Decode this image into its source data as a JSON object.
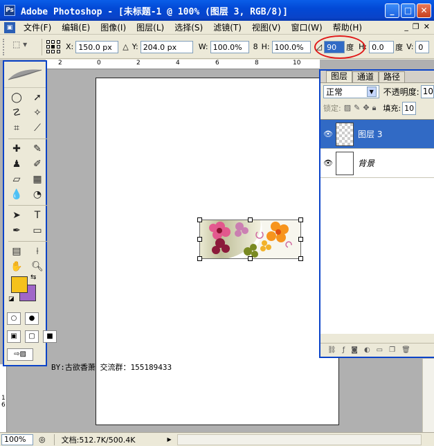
{
  "window": {
    "title": "Adobe Photoshop - [未标题-1 @ 100% (图层 3, RGB/8)]",
    "app_icon": "Ps",
    "minimize": "_",
    "maximize": "□",
    "close": "✕"
  },
  "menu": {
    "items": [
      "文件(F)",
      "编辑(E)",
      "图像(I)",
      "图层(L)",
      "选择(S)",
      "滤镜(T)",
      "视图(V)",
      "窗口(W)",
      "帮助(H)"
    ],
    "doc_minimize": "_",
    "doc_restore": "❐",
    "doc_close": "✕"
  },
  "options": {
    "x_label": "X:",
    "x_value": "150.0 px",
    "delta_icon": "△",
    "y_label": "Y:",
    "y_value": "204.0 px",
    "w_label": "W:",
    "w_value": "100.0%",
    "link_icon": "8",
    "h_label": "H:",
    "h_value": "100.0%",
    "angle_icon": "◿",
    "angle_value": "90",
    "angle_unit": "度",
    "hskew_label": "H:",
    "hskew_value": "0.0",
    "hskew_unit": "度",
    "vskew_label": "V:",
    "vskew_value": "0"
  },
  "ruler": {
    "top_ticks": [
      "2",
      "0",
      "2",
      "4",
      "6",
      "8",
      "10"
    ],
    "left_ticks": [
      "1",
      "6"
    ]
  },
  "canvas": {
    "credit": "BY:古欲香萧 交流群：155189433"
  },
  "colors": {
    "foreground": "#f5c21c",
    "background": "#a066c8",
    "accent": "#0a43c8",
    "selection": "#316ac5"
  },
  "layers_panel": {
    "tabs": [
      "图层",
      "通道",
      "路径"
    ],
    "blend_mode": "正常",
    "opacity_label": "不透明度:",
    "opacity_value": "10",
    "lock_label": "锁定:",
    "fill_label": "填充:",
    "fill_value": "10",
    "layers": [
      {
        "name": "图层 3",
        "visible": true,
        "active": true
      },
      {
        "name": "背景",
        "visible": true,
        "active": false
      }
    ]
  },
  "status": {
    "zoom": "100%",
    "doc_info": "文档:512.7K/500.4K"
  }
}
